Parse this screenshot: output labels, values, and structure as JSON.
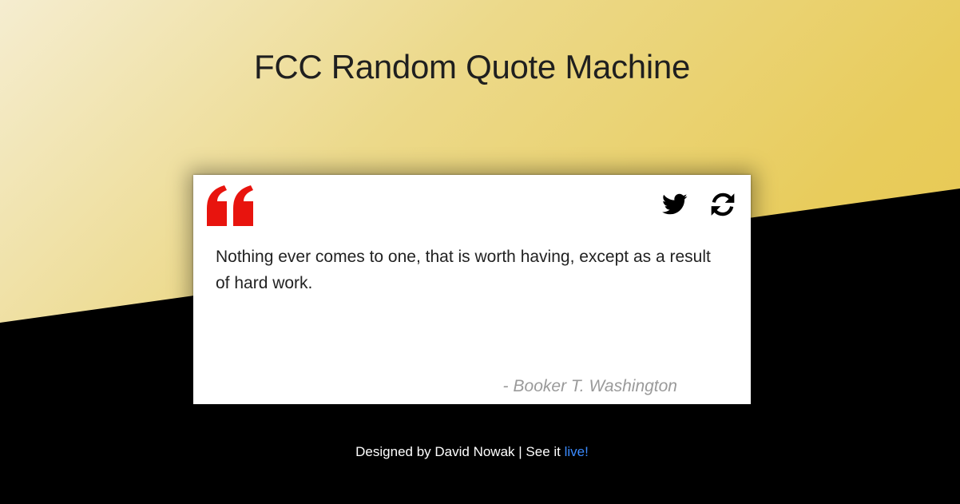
{
  "page": {
    "title": "FCC Random Quote Machine"
  },
  "quote": {
    "text": "Nothing ever comes to one, that is worth having, except as a result of hard work.",
    "author_prefix": "-",
    "author": "Booker T. Washington",
    "quote_mark_icon": "quote-left-icon",
    "quote_mark_color": "#e8140e"
  },
  "actions": {
    "tweet_icon": "twitter-icon",
    "refresh_icon": "refresh-icon"
  },
  "footer": {
    "designed_by": "Designed by David Nowak | See it",
    "live_link": "live!",
    "link_color": "#3b8bff"
  }
}
